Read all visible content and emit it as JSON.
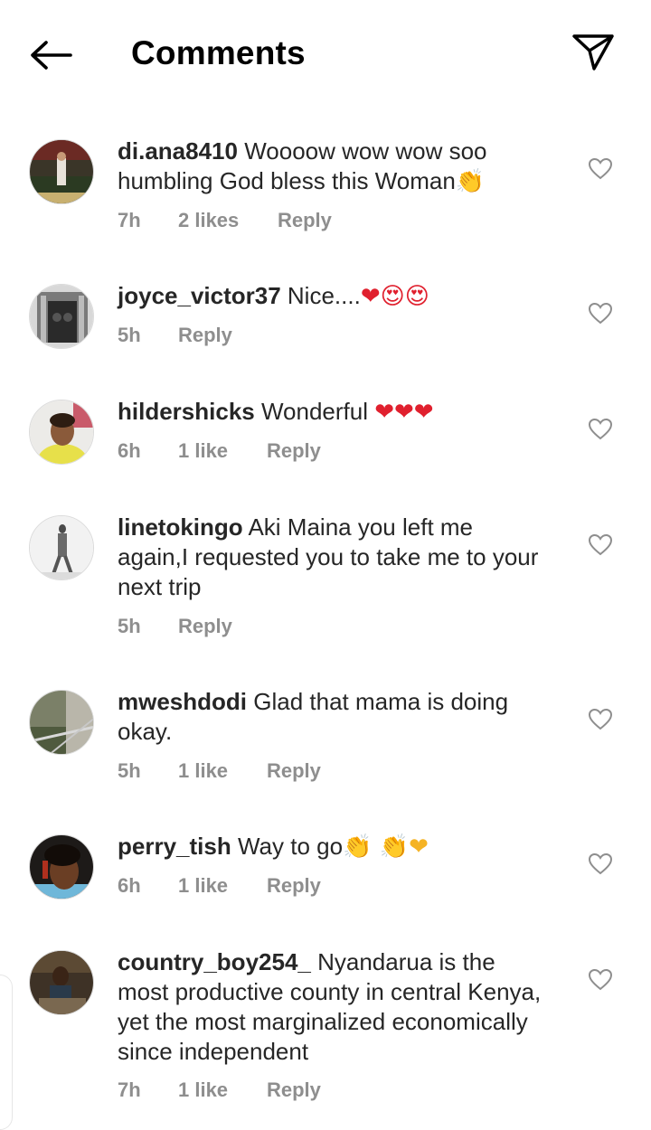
{
  "header": {
    "title": "Comments",
    "back_icon": "arrow-left-icon",
    "send_icon": "paper-plane-icon"
  },
  "colors": {
    "text": "#262626",
    "meta": "#8e8e8e",
    "red_heart": "#e0202e"
  },
  "comments": [
    {
      "username": "di.ana8410",
      "text": "Woooow wow wow soo humbling God bless this Woman",
      "emoji": "👏",
      "time": "7h",
      "likes": "2 likes",
      "reply": "Reply"
    },
    {
      "username": "joyce_victor37",
      "text": "Nice....",
      "emoji": "❤😍😍",
      "time": "5h",
      "likes": "",
      "reply": "Reply"
    },
    {
      "username": "hildershicks",
      "text": "Wonderful",
      "emoji": "❤❤❤",
      "time": "6h",
      "likes": "1 like",
      "reply": "Reply"
    },
    {
      "username": "linetokingo",
      "text": "Aki Maina you left me again,I requested you to take me to your next trip",
      "emoji": "",
      "time": "5h",
      "likes": "",
      "reply": "Reply"
    },
    {
      "username": "mweshdodi",
      "text": "Glad that mama is doing okay.",
      "emoji": "",
      "time": "5h",
      "likes": "1 like",
      "reply": "Reply"
    },
    {
      "username": "perry_tish",
      "text": "Way to go",
      "emoji": "👏 👏❤",
      "time": "6h",
      "likes": "1 like",
      "reply": "Reply"
    },
    {
      "username": "country_boy254_",
      "text": "Nyandarua is the most productive county in central Kenya, yet the most marginalized economically since independent",
      "emoji": "",
      "time": "7h",
      "likes": "1 like",
      "reply": "Reply"
    }
  ]
}
